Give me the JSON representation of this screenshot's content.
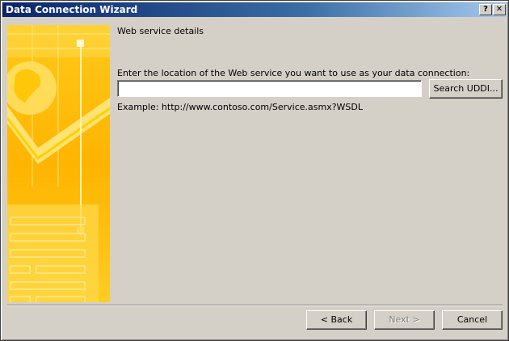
{
  "window": {
    "title": "Data Connection Wizard",
    "help_label": "?",
    "close_label": "✕"
  },
  "page": {
    "section_title": "Web service details",
    "prompt": "Enter the location of the Web service you want to use as your data connection:",
    "url_value": "",
    "example": "Example: http://www.contoso.com/Service.asmx?WSDL"
  },
  "buttons": {
    "search_uddi": "Search UDDI...",
    "back": "< Back",
    "next": "Next >",
    "cancel": "Cancel"
  },
  "colors": {
    "title_bar": "#0a246a",
    "banner_gold": "#ffcc00",
    "face": "#d4d0c8"
  },
  "banner": {
    "icon": "globe-checkmark-illustration"
  }
}
